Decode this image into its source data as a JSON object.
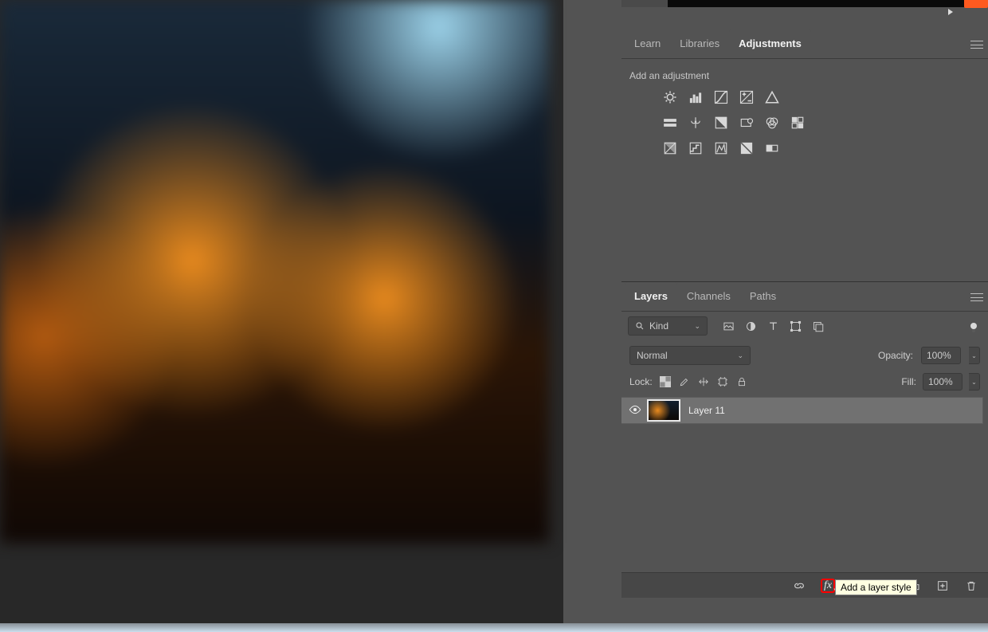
{
  "adjustments_panel": {
    "tabs": [
      "Learn",
      "Libraries",
      "Adjustments"
    ],
    "active_tab": "Adjustments",
    "hint": "Add an adjustment",
    "row1": [
      "brightness-contrast-icon",
      "levels-icon",
      "curves-icon",
      "exposure-icon",
      "vibrance-icon"
    ],
    "row2": [
      "hue-sat-icon",
      "color-balance-icon",
      "bw-icon",
      "photo-filter-icon",
      "channel-mixer-icon",
      "color-lookup-icon"
    ],
    "row3": [
      "invert-icon",
      "posterize-icon",
      "threshold-icon",
      "selective-color-icon",
      "gradient-map-icon"
    ]
  },
  "layers_panel": {
    "tabs": [
      "Layers",
      "Channels",
      "Paths"
    ],
    "active_tab": "Layers",
    "filter_label": "Kind",
    "blend_mode": "Normal",
    "opacity_label": "Opacity:",
    "opacity_value": "100%",
    "lock_label": "Lock:",
    "fill_label": "Fill:",
    "fill_value": "100%",
    "layer_name": "Layer 11"
  },
  "footer": {
    "tooltip": "Add a layer style",
    "fx_label": "fx"
  }
}
